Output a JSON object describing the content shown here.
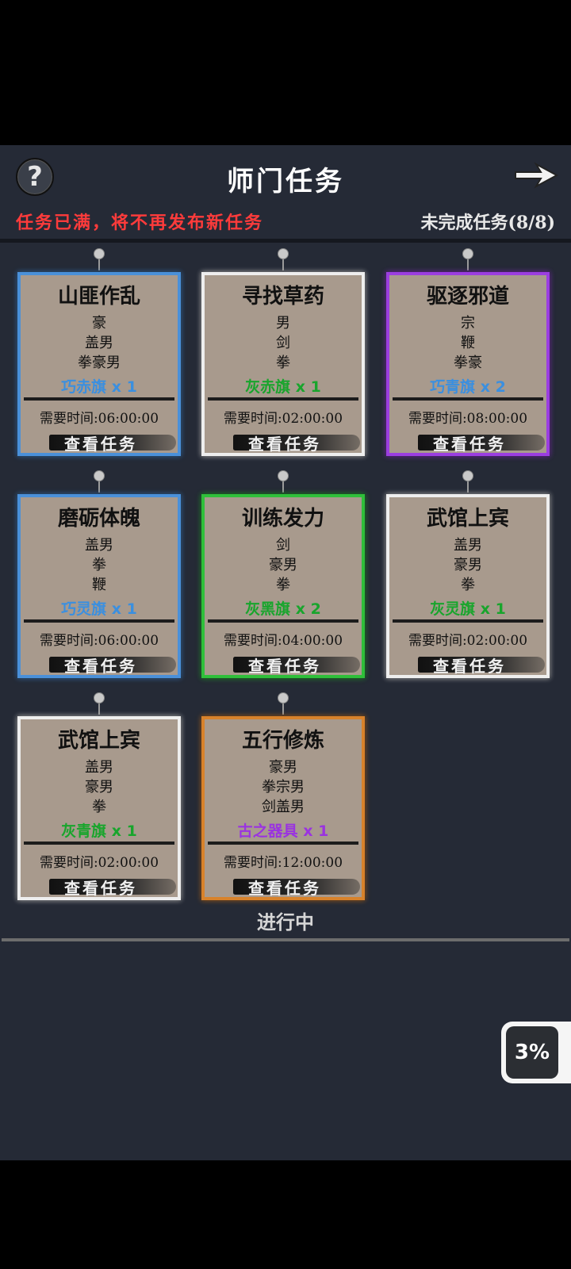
{
  "header": {
    "help_label": "?",
    "title": "师门任务",
    "notice": "任务已满，将不再发布新任务",
    "progress": "未完成任务(8/8)"
  },
  "colors": {
    "blue": "#4a90d9",
    "white": "#eeeeee",
    "purple": "#9b3ee0",
    "green": "#2fbf3a",
    "orange": "#d8822b",
    "reward_blue": "#3a8fe0",
    "reward_green": "#18a52c",
    "reward_purple": "#9a33e0"
  },
  "tasks": [
    {
      "title": "山匪作乱",
      "reqs": [
        "豪",
        "盖男",
        "拳豪男"
      ],
      "reward": "巧赤旗 x 1",
      "reward_color": "reward_blue",
      "border": "blue",
      "time": "需要时间:06:00:00",
      "button": "查看任务"
    },
    {
      "title": "寻找草药",
      "reqs": [
        "男",
        "剑",
        "拳"
      ],
      "reward": "灰赤旗 x 1",
      "reward_color": "reward_green",
      "border": "white",
      "time": "需要时间:02:00:00",
      "button": "查看任务"
    },
    {
      "title": "驱逐邪道",
      "reqs": [
        "宗",
        "鞭",
        "拳豪"
      ],
      "reward": "巧青旗 x 2",
      "reward_color": "reward_blue",
      "border": "purple",
      "time": "需要时间:08:00:00",
      "button": "查看任务"
    },
    {
      "title": "磨砺体魄",
      "reqs": [
        "盖男",
        "拳",
        "鞭"
      ],
      "reward": "巧灵旗 x 1",
      "reward_color": "reward_blue",
      "border": "blue",
      "time": "需要时间:06:00:00",
      "button": "查看任务"
    },
    {
      "title": "训练发力",
      "reqs": [
        "剑",
        "豪男",
        "拳"
      ],
      "reward": "灰黑旗 x 2",
      "reward_color": "reward_green",
      "border": "green",
      "time": "需要时间:04:00:00",
      "button": "查看任务"
    },
    {
      "title": "武馆上宾",
      "reqs": [
        "盖男",
        "豪男",
        "拳"
      ],
      "reward": "灰灵旗 x 1",
      "reward_color": "reward_green",
      "border": "white",
      "time": "需要时间:02:00:00",
      "button": "查看任务"
    },
    {
      "title": "武馆上宾",
      "reqs": [
        "盖男",
        "豪男",
        "拳"
      ],
      "reward": "灰青旗 x 1",
      "reward_color": "reward_green",
      "border": "white",
      "time": "需要时间:02:00:00",
      "button": "查看任务"
    },
    {
      "title": "五行修炼",
      "reqs": [
        "豪男",
        "拳宗男",
        "剑盖男"
      ],
      "reward": "古之器具 x 1",
      "reward_color": "reward_purple",
      "border": "orange",
      "time": "需要时间:12:00:00",
      "button": "查看任务"
    }
  ],
  "status": "进行中",
  "badge": "3%"
}
